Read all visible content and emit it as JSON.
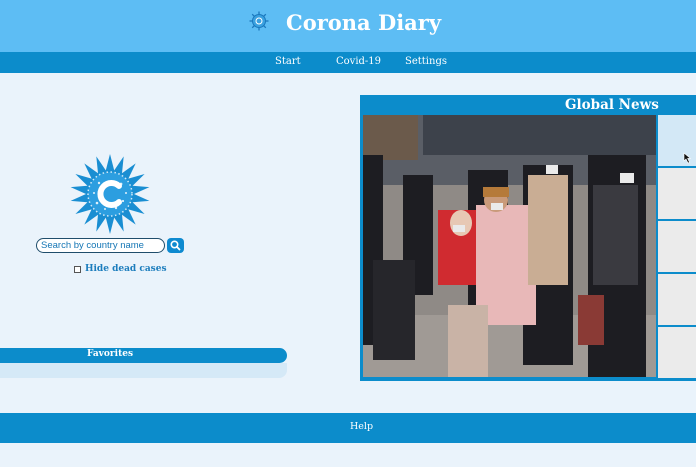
{
  "app": {
    "title": "Corona Diary",
    "logo_icon": "virus-icon"
  },
  "nav": {
    "items": [
      {
        "label": "Start"
      },
      {
        "label": "Covid-19"
      },
      {
        "label": "Settings"
      }
    ]
  },
  "search": {
    "placeholder": "Search by country name",
    "icon": "search-icon"
  },
  "filters": {
    "hide_dead_label": "Hide dead cases",
    "hide_dead_checked": false
  },
  "favorites": {
    "title": "Favorites",
    "items": []
  },
  "news": {
    "title": "Global News",
    "image_alt": "Travelers wearing face masks at a station",
    "slot_count": 5
  },
  "footer": {
    "help_label": "Help"
  },
  "colors": {
    "header": "#5dbdf4",
    "accent": "#0c8ccb",
    "background": "#eaf3fb"
  }
}
